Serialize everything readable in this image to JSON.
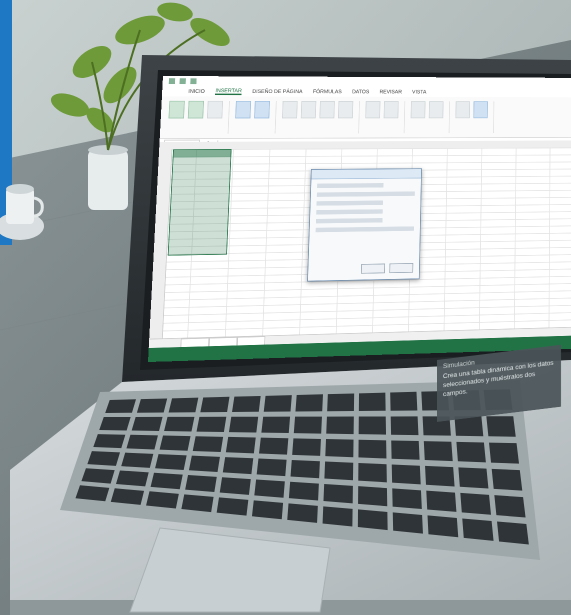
{
  "excel": {
    "ribbon_tabs": [
      "INICIO",
      "INSERTAR",
      "DISEÑO DE PÁGINA",
      "FÓRMULAS",
      "DATOS",
      "REVISAR",
      "VISTA"
    ]
  },
  "caption": {
    "heading": "Simulación",
    "body": "Crea una tabla dinámica con los datos seleccionados y muéstralos dos campos."
  },
  "colors": {
    "excel_green": "#217346",
    "accent_blue": "#1e78c4",
    "laptop_silver": "#bfc5c8",
    "key_dark": "#2f3438"
  }
}
